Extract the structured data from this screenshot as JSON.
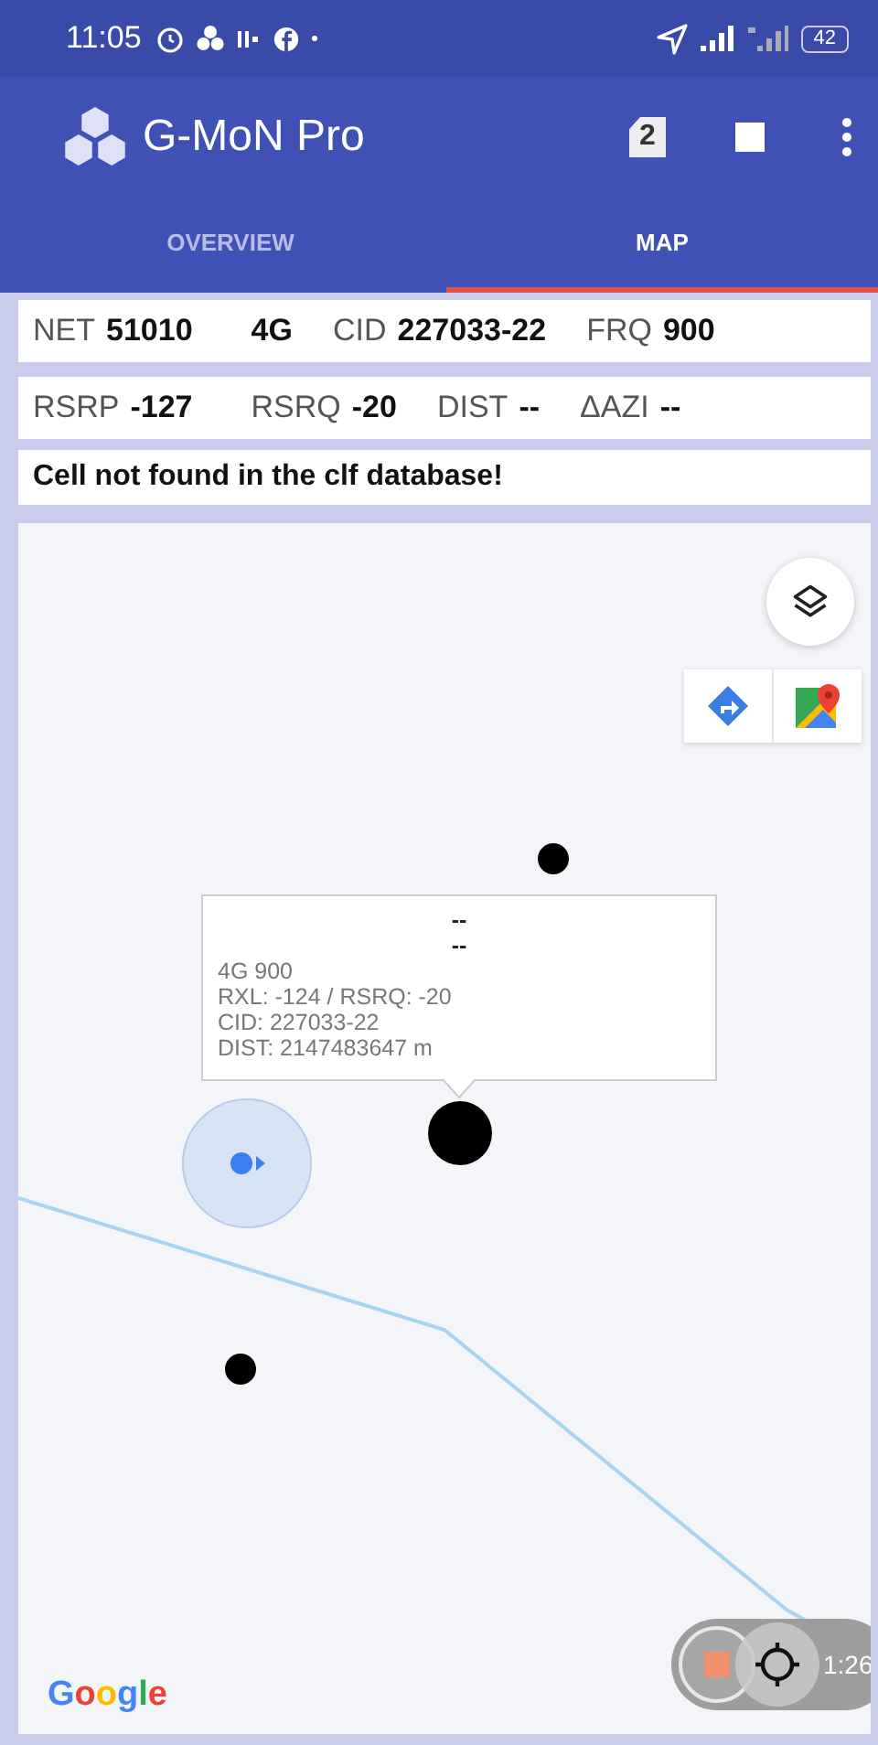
{
  "status_bar": {
    "time": "11:05",
    "battery": "42"
  },
  "app_bar": {
    "title": "G-MoN Pro",
    "sim_badge": "2"
  },
  "tabs": [
    {
      "label": "OVERVIEW",
      "selected": false
    },
    {
      "label": "MAP",
      "selected": true
    }
  ],
  "info_rows": [
    [
      {
        "label": "NET",
        "value": "51010"
      },
      {
        "value": "4G"
      },
      {
        "label": "CID",
        "value": "227033-22"
      },
      {
        "label": "FRQ",
        "value": "900"
      }
    ],
    [
      {
        "label": "RSRP",
        "value": "-127"
      },
      {
        "label": "RSRQ",
        "value": "-20"
      },
      {
        "label": "DIST",
        "value": "--"
      },
      {
        "label": "ΔAZI",
        "value": "--"
      }
    ]
  ],
  "message": "Cell not found in the clf database!",
  "map": {
    "callout": {
      "title_lines": [
        "--",
        "--"
      ],
      "lines": [
        "4G 900",
        "RXL: -124 / RSRQ: -20",
        "CID: 227033-22",
        "DIST: 2147483647 m"
      ]
    },
    "recording": {
      "time": "1:26"
    },
    "attribution": "Google"
  }
}
